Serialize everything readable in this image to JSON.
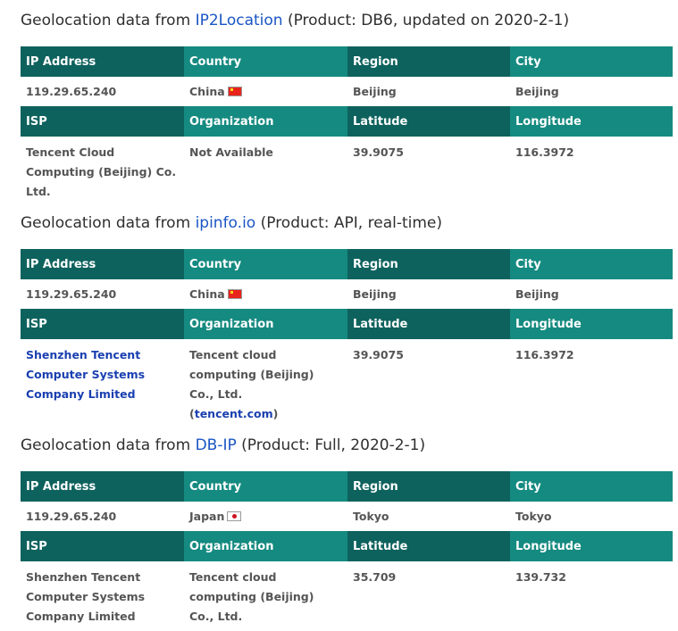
{
  "sections": [
    {
      "heading_prefix": "Geolocation data from ",
      "provider": "IP2Location",
      "heading_suffix": " (Product: DB6, updated on 2020-2-1)",
      "headers_top": [
        "IP Address",
        "Country",
        "Region",
        "City"
      ],
      "headers_bottom": [
        "ISP",
        "Organization",
        "Latitude",
        "Longitude"
      ],
      "ip": "119.29.65.240",
      "country": "China",
      "flag_icon": "china-flag-icon",
      "region": "Beijing",
      "city": "Beijing",
      "isp": "Tencent Cloud Computing (Beijing) Co. Ltd.",
      "organization": "Not Available",
      "latitude": "39.9075",
      "longitude": "116.3972"
    },
    {
      "heading_prefix": "Geolocation data from ",
      "provider": "ipinfo.io",
      "heading_suffix": " (Product: API, real-time)",
      "headers_top": [
        "IP Address",
        "Country",
        "Region",
        "City"
      ],
      "headers_bottom": [
        "ISP",
        "Organization",
        "Latitude",
        "Longitude"
      ],
      "ip": "119.29.65.240",
      "country": "China",
      "flag_icon": "china-flag-icon",
      "region": "Beijing",
      "city": "Beijing",
      "isp": "Shenzhen Tencent Computer Systems Company Limited",
      "organization_text": "Tencent cloud computing (Beijing) Co., Ltd.",
      "organization_paren_open": "(",
      "organization_link": "tencent.com",
      "organization_paren_close": ")",
      "latitude": "39.9075",
      "longitude": "116.3972"
    },
    {
      "heading_prefix": "Geolocation data from ",
      "provider": "DB-IP",
      "heading_suffix": " (Product: Full, 2020-2-1)",
      "headers_top": [
        "IP Address",
        "Country",
        "Region",
        "City"
      ],
      "headers_bottom": [
        "ISP",
        "Organization",
        "Latitude",
        "Longitude"
      ],
      "ip": "119.29.65.240",
      "country": "Japan",
      "flag_icon": "japan-flag-icon",
      "region": "Tokyo",
      "city": "Tokyo",
      "isp": "Shenzhen Tencent Computer Systems Company Limited",
      "organization": "Tencent cloud computing (Beijing) Co., Ltd.",
      "latitude": "35.709",
      "longitude": "139.732"
    }
  ],
  "colors": {
    "header_dark": "#0e625e",
    "header_light": "#158a80",
    "link": "#1a56c4"
  }
}
